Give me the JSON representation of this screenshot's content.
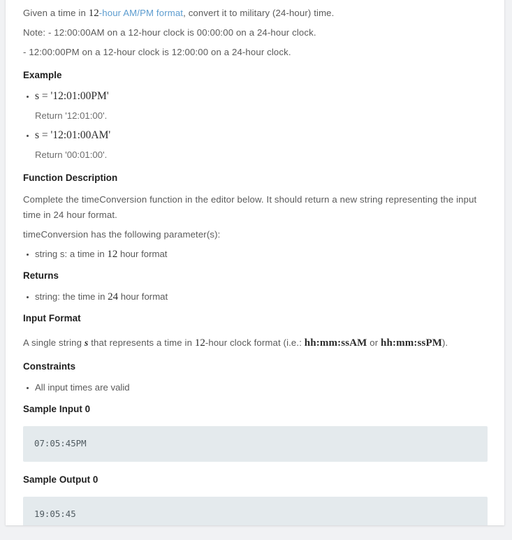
{
  "colors": {
    "page_bg": "#f1f2f4",
    "card_bg": "#ffffff",
    "body_text": "#5a5a5a",
    "heading_text": "#1f1f1f",
    "link": "#5c9ccf",
    "code_bg": "#e4eaed",
    "code_text": "#4f5a60"
  },
  "intro": {
    "lead_prefix": "Given a time in ",
    "lead_math": "12",
    "lead_link": "-hour AM/PM format",
    "lead_suffix": ", convert it to military (24-hour) time.",
    "note_line_1": "Note: - 12:00:00AM on a 12-hour clock is 00:00:00 on a 24-hour clock.",
    "note_line_2": "- 12:00:00PM on a 12-hour clock is 12:00:00 on a 24-hour clock."
  },
  "example": {
    "heading": "Example",
    "items": [
      {
        "expr": "s = '12:01:00PM'",
        "return_text": "Return '12:01:00'."
      },
      {
        "expr": "s = '12:01:00AM'",
        "return_text": "Return '00:01:00'."
      }
    ]
  },
  "function_description": {
    "heading": "Function Description",
    "paragraph": "Complete the timeConversion function in the editor below. It should return a new string representing the input time in 24 hour format.",
    "params_intro": "timeConversion has the following parameter(s):",
    "param_prefix": "string s: a time in ",
    "param_math": "12",
    "param_suffix": " hour format"
  },
  "returns": {
    "heading": "Returns",
    "item_prefix": "string: the time in ",
    "item_math": "24",
    "item_suffix": " hour format"
  },
  "input_format": {
    "heading": "Input Format",
    "part_1": "A single string ",
    "var_s": "s",
    "part_2": " that represents a time in ",
    "math_12": "12",
    "part_3": "-hour clock format (i.e.: ",
    "math_am": "hh:mm:ssAM",
    "part_4": " or ",
    "math_pm": "hh:mm:ssPM",
    "part_5": ")."
  },
  "constraints": {
    "heading": "Constraints",
    "items": [
      "All input times are valid"
    ]
  },
  "sample_input": {
    "heading": "Sample Input 0",
    "code": "07:05:45PM"
  },
  "sample_output": {
    "heading": "Sample Output 0",
    "code": "19:05:45"
  }
}
